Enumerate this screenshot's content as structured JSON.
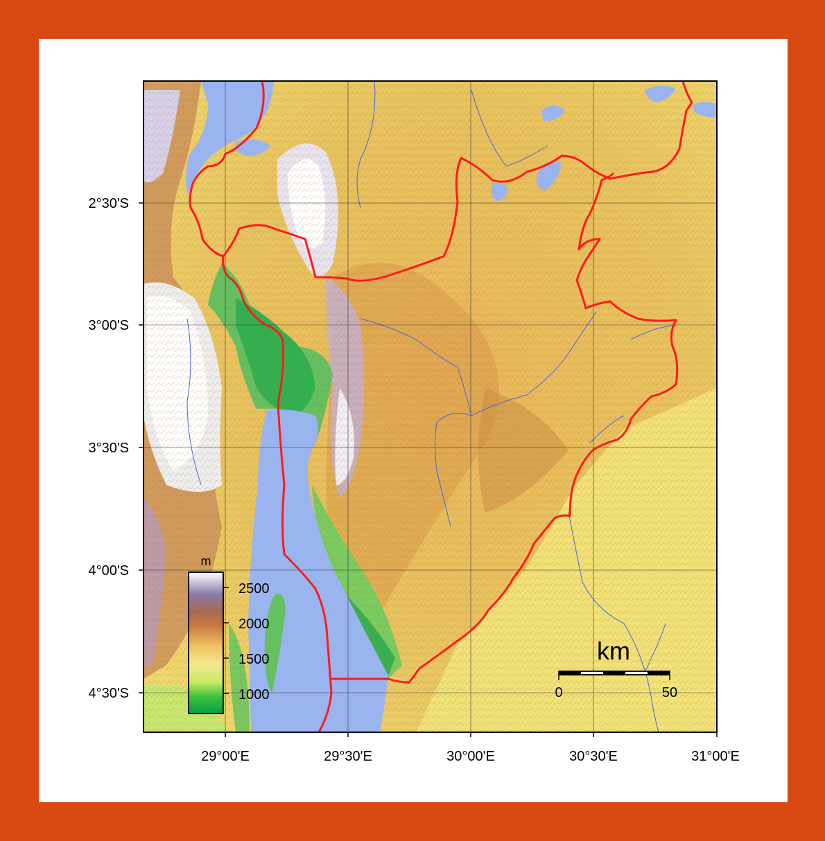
{
  "map": {
    "lat_labels": [
      "2°30'S",
      "3°00'S",
      "3°30'S",
      "4°00'S",
      "4°30'S"
    ],
    "lon_labels": [
      "29°00'E",
      "29°30'E",
      "30°00'E",
      "30°30'E",
      "31°00'E"
    ],
    "elevation_legend": {
      "unit": "m",
      "ticks": [
        "2500",
        "2000",
        "1500",
        "1000"
      ]
    },
    "scale_bar": {
      "unit": "km",
      "start_label": "0",
      "end_label": "50"
    },
    "colors": {
      "frame": "#d94a12",
      "border": "#ff1a1a",
      "water": "#9ab4f0",
      "river": "#4466dd"
    }
  }
}
